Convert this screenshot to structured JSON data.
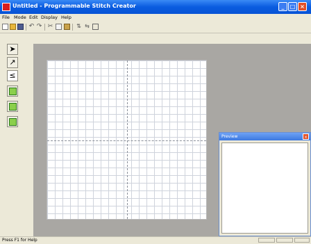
{
  "window": {
    "title": "Untitled - Programmable Stitch Creator"
  },
  "title_buttons": {
    "minimize": "_",
    "maximize": "□",
    "close": "×"
  },
  "menu": [
    "File",
    "Mode",
    "Edit",
    "Display",
    "Help"
  ],
  "toolbar": {
    "icons": [
      "new-icon",
      "open-icon",
      "save-icon",
      "undo-icon",
      "redo-icon",
      "cut-icon",
      "copy-icon",
      "paste-icon",
      "flip-icon",
      "mirror-icon",
      "square-icon"
    ]
  },
  "left_tools": [
    {
      "name": "select-arrow-icon",
      "glyph": "➤"
    },
    {
      "name": "point-edit-icon",
      "glyph": "↗"
    },
    {
      "name": "zigzag-icon",
      "glyph": "≤"
    },
    {
      "name": "stitch-a-icon",
      "glyph": ""
    },
    {
      "name": "stitch-b-icon",
      "glyph": ""
    },
    {
      "name": "stitch-c-icon",
      "glyph": ""
    }
  ],
  "preview": {
    "title": "Preview",
    "close": "×"
  },
  "status": {
    "text": "Press F1 for Help"
  },
  "colors": {
    "titlebar": "#0a5ce0",
    "workspace": "#a9a7a3",
    "grid": "#cfd3dc"
  }
}
